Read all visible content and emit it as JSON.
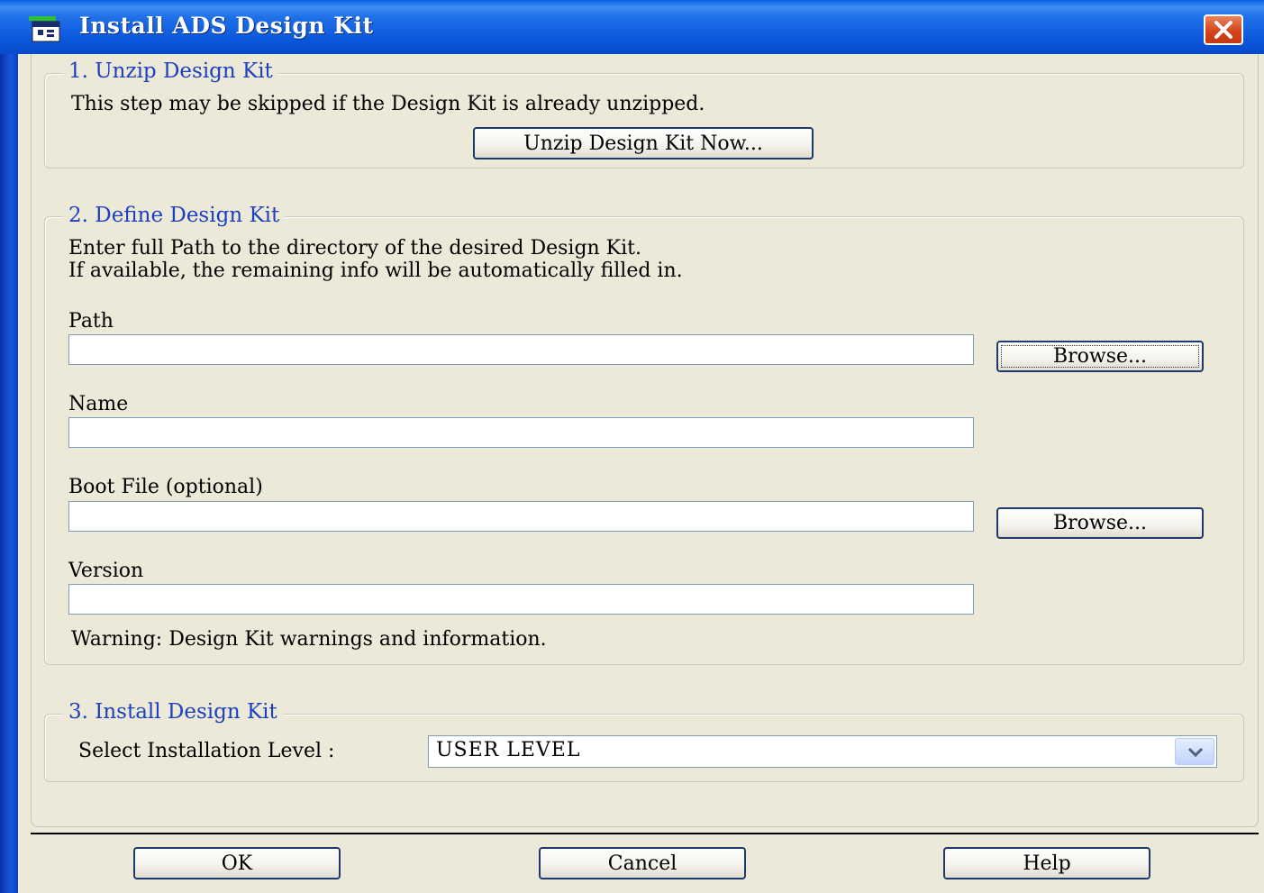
{
  "window": {
    "title": "Install ADS Design Kit"
  },
  "section1": {
    "title": "1. Unzip Design Kit",
    "description": "This step may be skipped if the Design Kit is already unzipped.",
    "unzip_button": "Unzip Design Kit Now..."
  },
  "section2": {
    "title": "2. Define Design Kit",
    "instructions_line1": "Enter full Path to the directory of the desired Design Kit.",
    "instructions_line2": "If available, the remaining info will be automatically filled in.",
    "path_label": "Path",
    "path_value": "",
    "path_browse": "Browse...",
    "name_label": "Name",
    "name_value": "",
    "boot_label": "Boot File (optional)",
    "boot_value": "",
    "boot_browse": "Browse...",
    "version_label": "Version",
    "version_value": "",
    "warning": "Warning: Design Kit warnings and information."
  },
  "section3": {
    "title": "3. Install Design Kit",
    "level_label": "Select Installation Level :",
    "level_value": "USER LEVEL"
  },
  "buttons": {
    "ok": "OK",
    "cancel": "Cancel",
    "help": "Help"
  }
}
